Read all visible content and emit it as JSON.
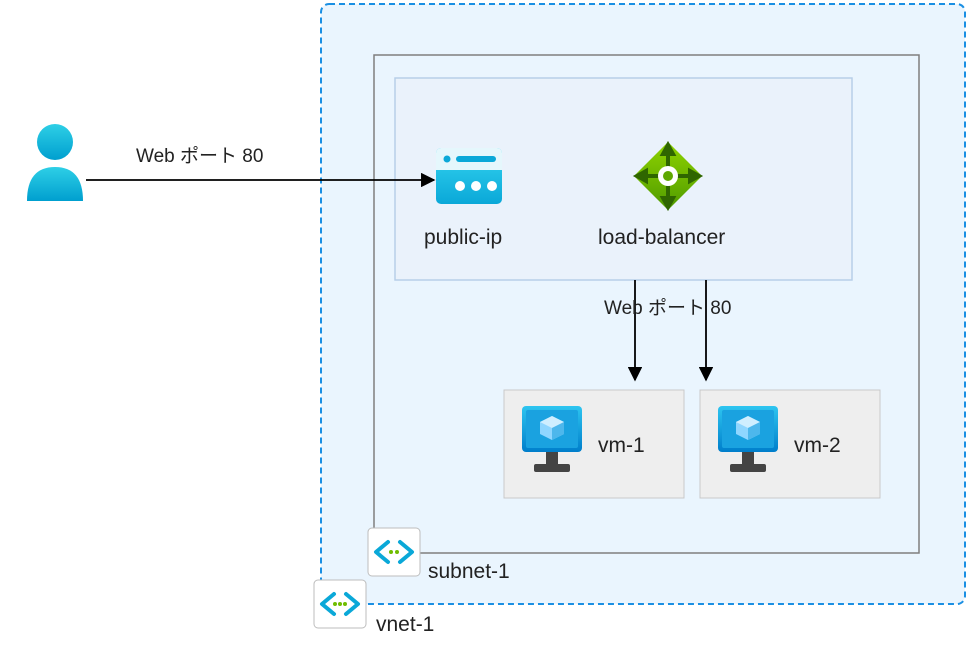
{
  "edges": {
    "user_to_publicip": "Web ポート 80",
    "lb_to_vms": "Web ポート 80"
  },
  "nodes": {
    "public_ip": "public-ip",
    "load_balancer": "load-balancer",
    "vm1": "vm-1",
    "vm2": "vm-2",
    "subnet": "subnet-1",
    "vnet": "vnet-1"
  },
  "colors": {
    "azure_blue": "#0ea5e9",
    "azure_cyan": "#22c3e6",
    "vnet_fill": "#eaf5fe",
    "vnet_stroke": "#1a8fe3",
    "subnet_stroke": "#7f7f7f",
    "inner_box_fill": "#eaf2fb",
    "inner_box_stroke": "#b7cfe8",
    "vm_box_fill": "#eeeeee",
    "lb_green": "#79b400",
    "lb_green_dark": "#4f8a00"
  }
}
